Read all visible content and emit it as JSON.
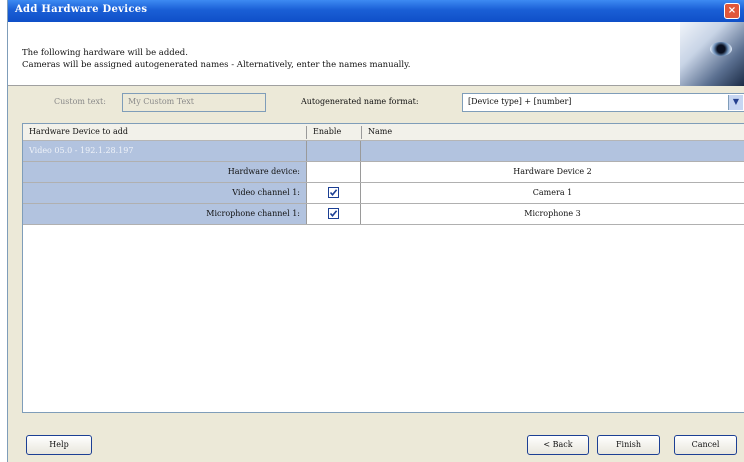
{
  "window": {
    "title": "Add Hardware Devices",
    "close_glyph": "×"
  },
  "header": {
    "line1": "The following hardware will be added.",
    "line2": "Cameras will be assigned autogenerated names - Alternatively, enter the names manually."
  },
  "options": {
    "custom_text_label": "Custom text:",
    "custom_text_value": "My Custom Text",
    "autogen_label": "Autogenerated name format:",
    "autogen_value": "[Device type] + [number]"
  },
  "table": {
    "columns": [
      "Hardware Device to add",
      "Enable",
      "Name"
    ],
    "rows": [
      {
        "device": "Video 05.0 - 192.1.28.197",
        "enabled": null,
        "name": ""
      },
      {
        "device": "Hardware device:",
        "enabled": null,
        "name": "Hardware Device 2"
      },
      {
        "device": "Video channel 1:",
        "enabled": true,
        "name": "Camera 1"
      },
      {
        "device": "Microphone channel 1:",
        "enabled": true,
        "name": "Microphone 3"
      }
    ]
  },
  "buttons": {
    "help": "Help",
    "back": "< Back",
    "finish": "Finish",
    "cancel": "Cancel"
  },
  "colors": {
    "title_bar": "#1a5fd6",
    "row_highlight": "#b2c3df",
    "dialog_bg": "#ece9d8"
  },
  "icons": {
    "checkbox": "checkbox-checked-icon",
    "dropdown": "chevron-down-icon",
    "logo": "eye-logo"
  }
}
